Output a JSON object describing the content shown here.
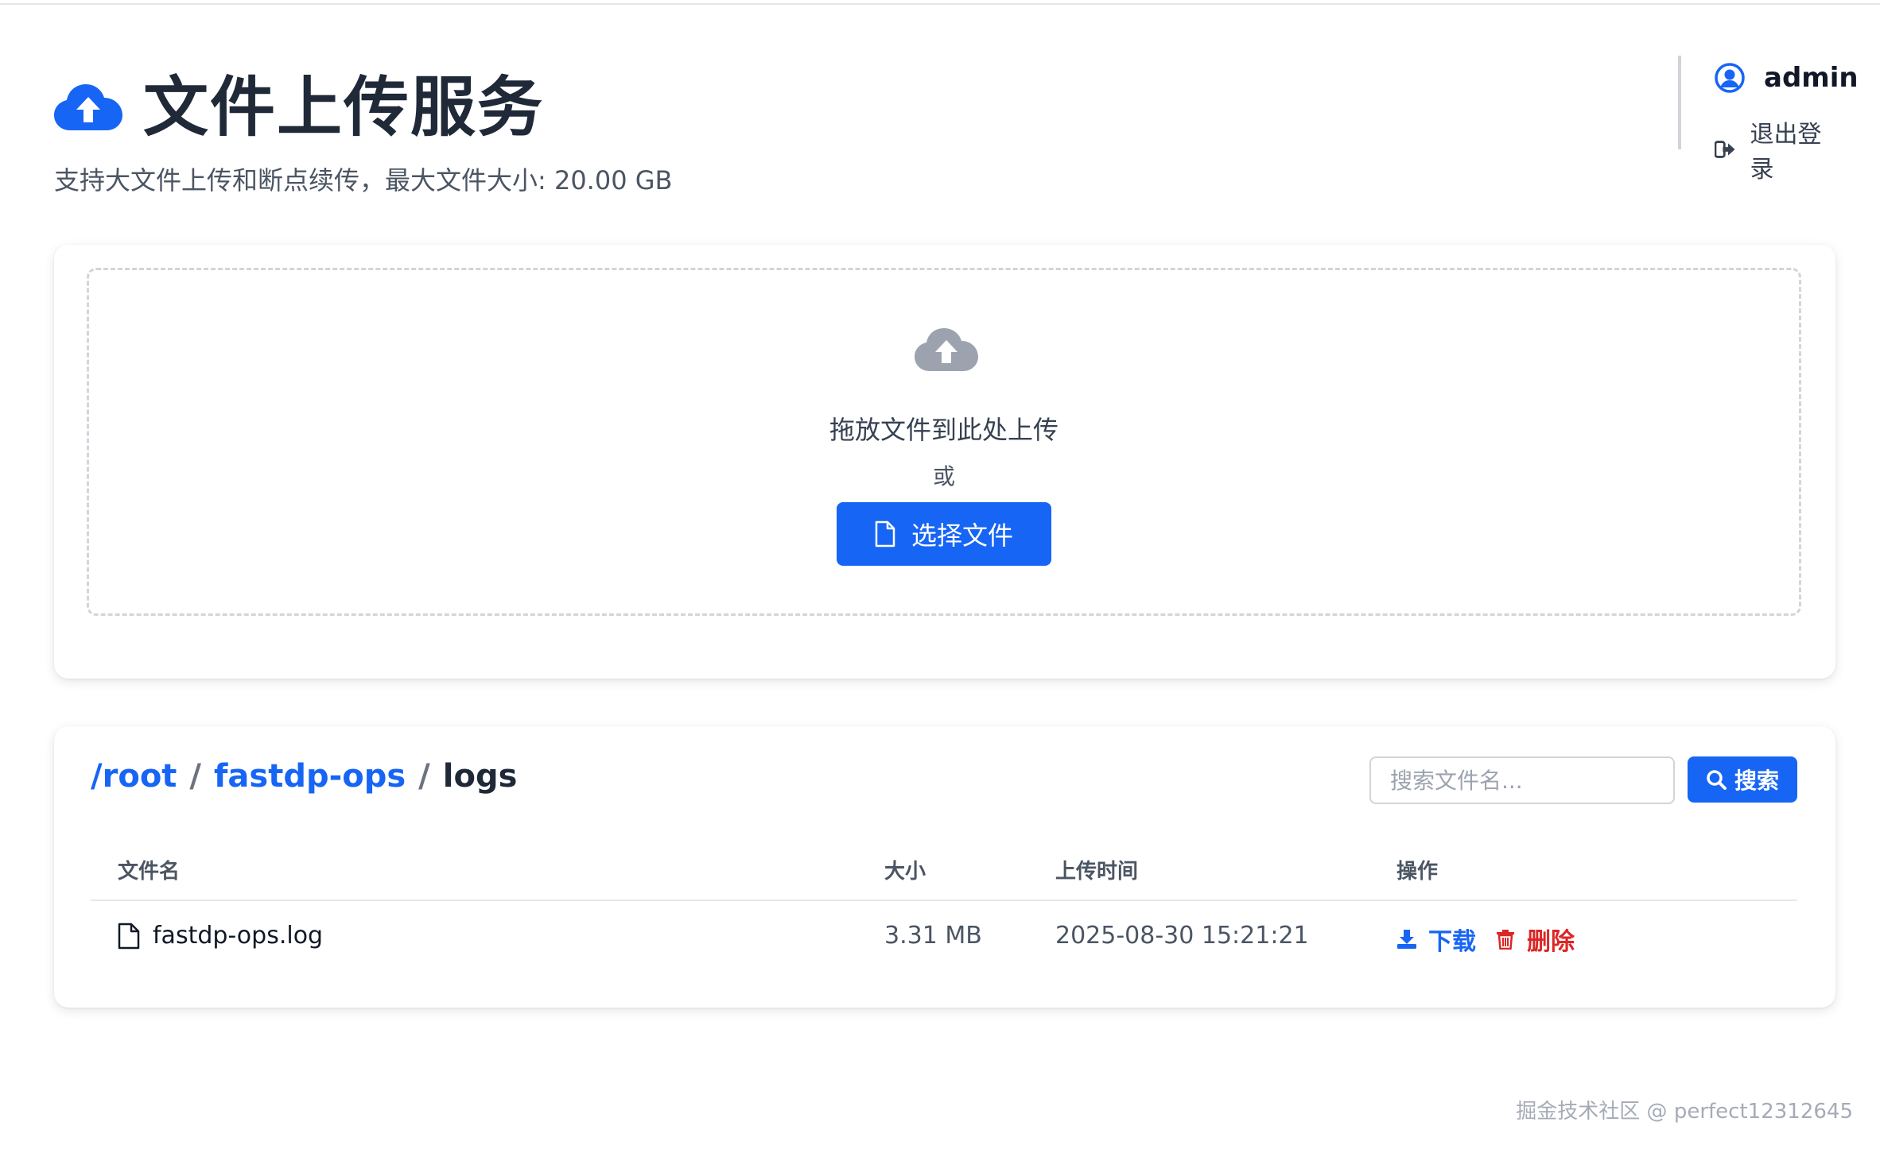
{
  "header": {
    "title": "文件上传服务",
    "subtitle": "支持大文件上传和断点续传，最大文件大小: 20.00 GB",
    "brand_color": "#1765f5"
  },
  "user": {
    "username": "admin",
    "logout_label": "退出登录"
  },
  "upload": {
    "drop_text": "拖放文件到此处上传",
    "or_text": "或",
    "choose_button_label": "选择文件"
  },
  "browser": {
    "breadcrumb": [
      {
        "label": "/root",
        "link": true
      },
      {
        "label": "fastdp-ops",
        "link": true
      },
      {
        "label": "logs",
        "link": false
      }
    ],
    "separator": "/",
    "search": {
      "placeholder": "搜索文件名...",
      "value": "",
      "button_label": "搜索"
    },
    "columns": [
      "文件名",
      "大小",
      "上传时间",
      "操作"
    ],
    "rows": [
      {
        "name": "fastdp-ops.log",
        "size": "3.31 MB",
        "uploaded_at": "2025-08-30 15:21:21",
        "download_label": "下载",
        "delete_label": "删除"
      }
    ]
  },
  "watermark": "掘金技术社区 @ perfect12312645",
  "colors": {
    "primary": "#1765f5",
    "danger": "#dc2626",
    "muted_icon": "#9ca3af"
  }
}
